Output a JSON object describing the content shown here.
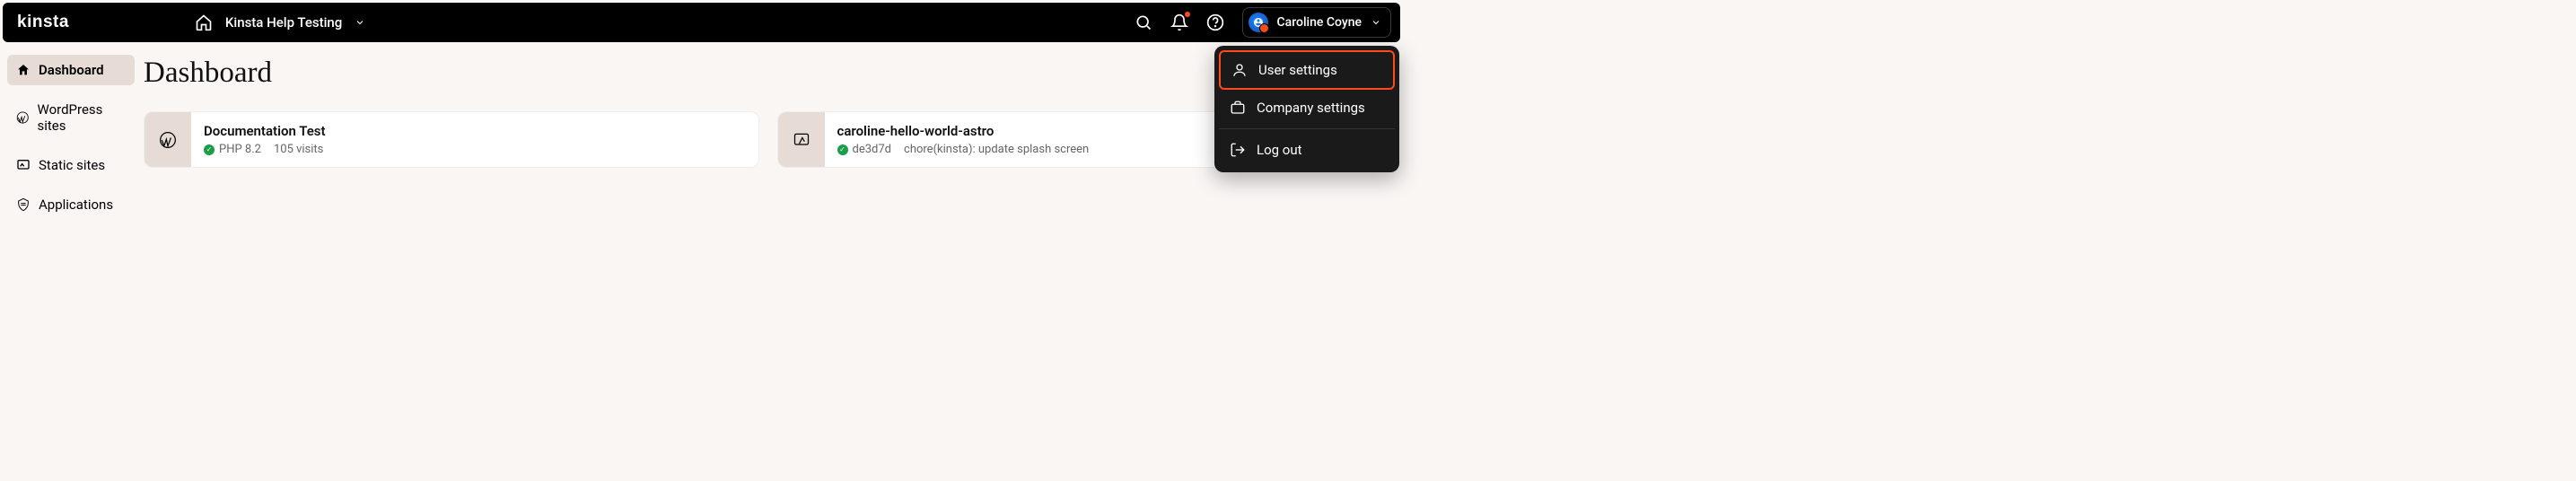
{
  "brand": "kinsta",
  "breadcrumb": {
    "company": "Kinsta Help Testing"
  },
  "user": {
    "name": "Caroline Coyne",
    "menu": {
      "user_settings": "User settings",
      "company_settings": "Company settings",
      "log_out": "Log out"
    }
  },
  "nav": {
    "dashboard": "Dashboard",
    "wordpress_sites": "WordPress sites",
    "static_sites": "Static sites",
    "applications": "Applications"
  },
  "page_title": "Dashboard",
  "cards": [
    {
      "title": "Documentation Test",
      "status_text": "PHP 8.2",
      "meta": "105 visits",
      "type": "wordpress"
    },
    {
      "title": "caroline-hello-world-astro",
      "status_text": "de3d7d",
      "meta": "chore(kinsta): update splash screen",
      "type": "static"
    }
  ]
}
